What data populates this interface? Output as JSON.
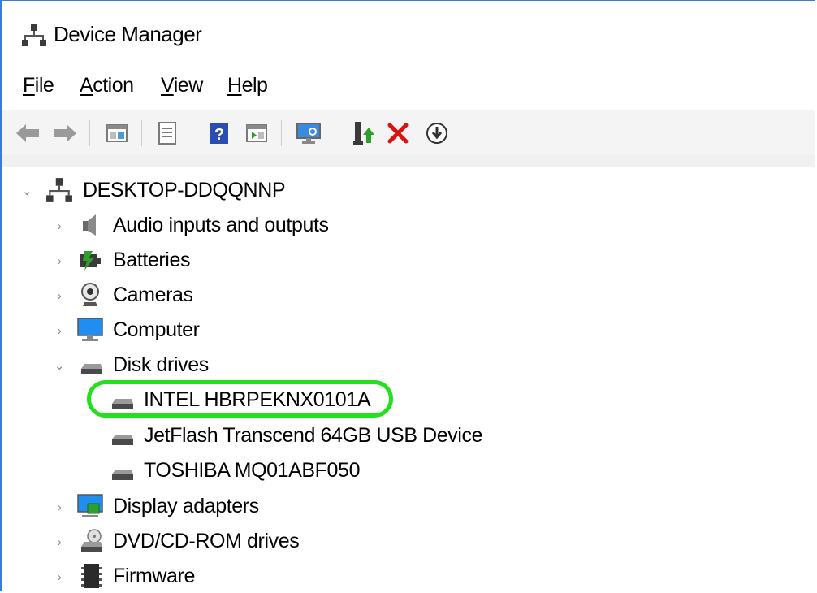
{
  "window": {
    "title": "Device Manager"
  },
  "menu": [
    {
      "accel": "F",
      "rest": "ile"
    },
    {
      "accel": "A",
      "rest": "ction"
    },
    {
      "accel": "V",
      "rest": "iew"
    },
    {
      "accel": "H",
      "rest": "elp"
    }
  ],
  "toolbar": {
    "buttons": [
      "back-arrow-icon",
      "forward-arrow-icon",
      "show-hide-tree-icon",
      "properties-icon",
      "help-icon",
      "run-action-icon",
      "scan-hardware-icon",
      "update-driver-icon",
      "uninstall-device-icon",
      "disable-device-icon"
    ]
  },
  "tree": {
    "root": {
      "label": "DESKTOP-DDQQNNP",
      "expanded": true
    },
    "categories": [
      {
        "label": "Audio inputs and outputs",
        "expanded": false
      },
      {
        "label": "Batteries",
        "expanded": false
      },
      {
        "label": "Cameras",
        "expanded": false
      },
      {
        "label": "Computer",
        "expanded": false
      },
      {
        "label": "Disk drives",
        "expanded": true,
        "children": [
          {
            "label": "INTEL HBRPEKNX0101A",
            "highlighted": true
          },
          {
            "label": "JetFlash Transcend 64GB USB Device"
          },
          {
            "label": "TOSHIBA MQ01ABF050"
          }
        ]
      },
      {
        "label": "Display adapters",
        "expanded": false
      },
      {
        "label": "DVD/CD-ROM drives",
        "expanded": false
      },
      {
        "label": "Firmware",
        "expanded": false
      }
    ]
  },
  "colors": {
    "highlight": "#22e01a",
    "uninstall_red": "#e01010",
    "window_border": "#3a7bd5"
  }
}
